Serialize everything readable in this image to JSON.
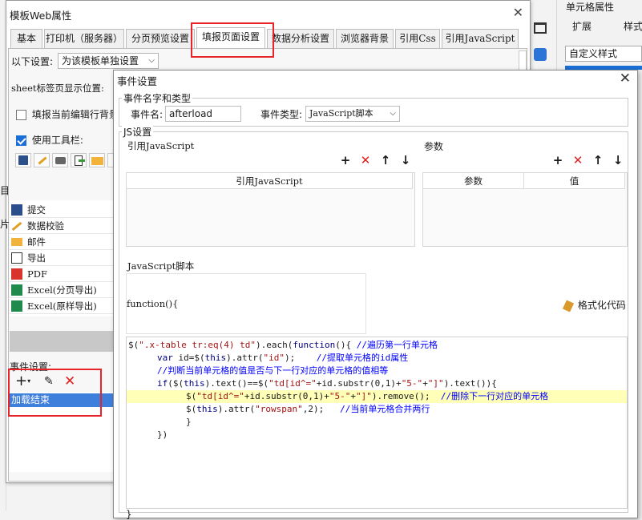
{
  "background_panel": {
    "title": "单元格属性",
    "tabs": [
      "扩展",
      "样式"
    ],
    "select_value": "自定义样式"
  },
  "template_window": {
    "title": "模板Web属性",
    "tabs": [
      "基本",
      "打印机（服务器）",
      "分页预览设置",
      "填报页面设置",
      "数据分析设置",
      "浏览器背景",
      "引用Css",
      "引用JavaScript"
    ],
    "active_tab": "填报页面设置",
    "settings_label": "以下设置:",
    "settings_select": "为该模板单独设置",
    "sheet_label": "sheet标签页显示位置:",
    "fill_bg_label": "填报当前编辑行背景",
    "use_toolbar_label": "使用工具栏:",
    "toolbar_items": [
      {
        "label": "提交",
        "icon": "save-icon"
      },
      {
        "label": "数据校验",
        "icon": "pencil-check-icon"
      },
      {
        "label": "邮件",
        "icon": "mail-icon"
      },
      {
        "label": "导出",
        "icon": "export-icon"
      },
      {
        "label": "PDF",
        "icon": "pdf-icon"
      },
      {
        "label": "Excel(分页导出)",
        "icon": "excel-icon"
      },
      {
        "label": "Excel(原样导出)",
        "icon": "excel-icon"
      }
    ],
    "event_settings_label": "事件设置:",
    "event_item": "加载结束",
    "side_letters": [
      "目",
      "片"
    ]
  },
  "dialog": {
    "title": "事件设置",
    "name_type_group": "事件名字和类型",
    "event_name_label": "事件名:",
    "event_name_value": "afterload",
    "event_type_label": "事件类型:",
    "event_type_value": "JavaScript脚本",
    "js_group": "JS设置",
    "ref_js_label": "引用JavaScript",
    "ref_js_column": "引用JavaScript",
    "params_label": "参数",
    "params_columns": [
      "参数",
      "值"
    ],
    "script_label": "JavaScript脚本",
    "function_header": "function(){",
    "format_button": "格式化代码",
    "closing_brace": "}"
  },
  "code_lines": [
    {
      "text": "$(\".x-table tr:eq(4) td\").each(function(){ //遍历第一行单元格",
      "indent": 0,
      "highlight": false
    },
    {
      "text": "var id=$(this).attr(\"id\");    //提取单元格的id属性",
      "indent": 1,
      "highlight": false
    },
    {
      "text": "//判断当前单元格的值是否与下一行对应的单元格的值相等",
      "indent": 1,
      "highlight": false
    },
    {
      "text": "if($(this).text()==$(\"td[id^=\"+id.substr(0,1)+\"5-\"+\"]\").text()){",
      "indent": 1,
      "highlight": false
    },
    {
      "text": "$(\"td[id^=\"+id.substr(0,1)+\"5-\"+\"]\").remove();  //删除下一行对应的单元格",
      "indent": 2,
      "highlight": true
    },
    {
      "text": "$(this).attr(\"rowspan\",2);   //当前单元格合并两行",
      "indent": 2,
      "highlight": false
    },
    {
      "text": "}",
      "indent": 2,
      "highlight": false
    },
    {
      "text": "})",
      "indent": 1,
      "highlight": false
    }
  ],
  "colors": {
    "accent": "#1a6fd6",
    "annotation_red": "#e8232a",
    "delete_red": "#e02020",
    "highlight_line": "#ffffb8",
    "selected_item": "#3f7fdc"
  }
}
